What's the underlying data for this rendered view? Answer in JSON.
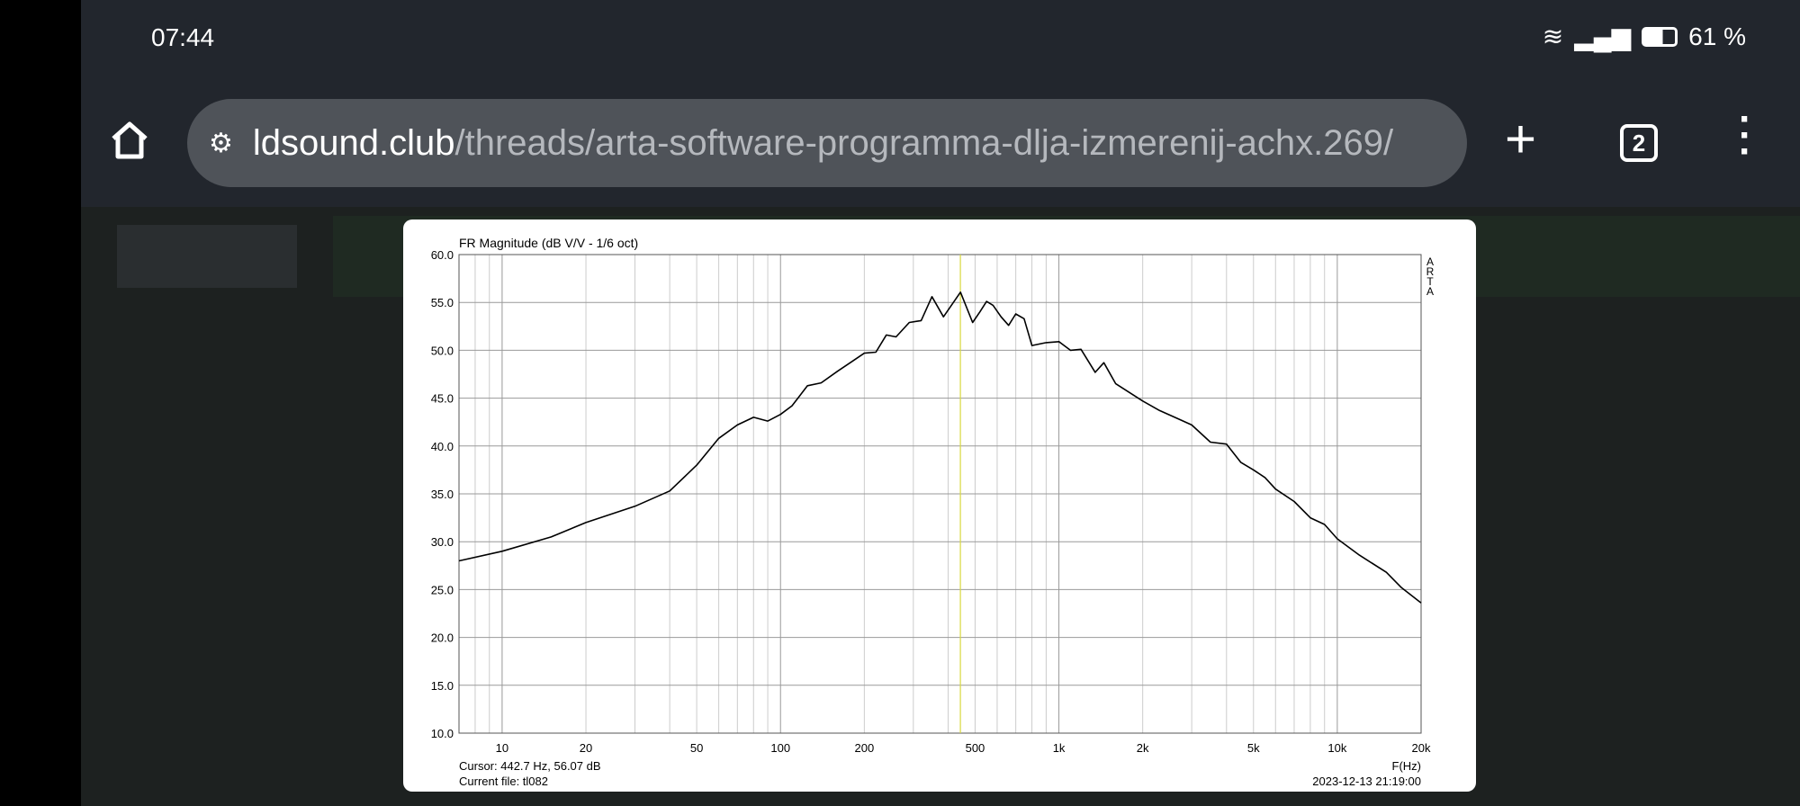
{
  "status_bar": {
    "time": "07:44",
    "battery": "61 %"
  },
  "browser": {
    "url_host": "ldsound.club",
    "url_path": "/threads/arta-software-programma-dlja-izmerenij-achx.269/",
    "tab_count": "2"
  },
  "chart_data": {
    "type": "line",
    "title": "FR Magnitude (dB V/V - 1/6 oct)",
    "xlabel": "F(Hz)",
    "x_scale": "log",
    "xlim": [
      7,
      20000
    ],
    "ylim": [
      10,
      60
    ],
    "yticks": [
      "60.0",
      "55.0",
      "50.0",
      "45.0",
      "40.0",
      "35.0",
      "30.0",
      "25.0",
      "20.0",
      "15.0",
      "10.0"
    ],
    "xticks": [
      {
        "v": 10,
        "l": "10"
      },
      {
        "v": 20,
        "l": "20"
      },
      {
        "v": 50,
        "l": "50"
      },
      {
        "v": 100,
        "l": "100"
      },
      {
        "v": 200,
        "l": "200"
      },
      {
        "v": 500,
        "l": "500"
      },
      {
        "v": 1000,
        "l": "1k"
      },
      {
        "v": 2000,
        "l": "2k"
      },
      {
        "v": 5000,
        "l": "5k"
      },
      {
        "v": 10000,
        "l": "10k"
      },
      {
        "v": 20000,
        "l": "20k"
      }
    ],
    "grid": true,
    "watermark": "ARTA",
    "cursor": {
      "freq": 442.7,
      "text": "Cursor: 442.7 Hz, 56.07 dB"
    },
    "current_file": "Current file: tl082",
    "timestamp": "2023-12-13  21:19:00",
    "series": [
      {
        "name": "tl082",
        "color": "#000000",
        "x": [
          7,
          10,
          15,
          20,
          30,
          40,
          50,
          60,
          70,
          80,
          90,
          100,
          110,
          125,
          140,
          160,
          180,
          200,
          220,
          240,
          260,
          290,
          320,
          350,
          385,
          443,
          490,
          520,
          550,
          580,
          620,
          660,
          700,
          750,
          800,
          900,
          1000,
          1100,
          1200,
          1350,
          1450,
          1600,
          2000,
          2300,
          2700,
          3000,
          3500,
          4000,
          4500,
          5000,
          5500,
          6000,
          7000,
          8000,
          9000,
          10000,
          12000,
          15000,
          17000,
          20000
        ],
        "y": [
          28.0,
          29.0,
          30.5,
          32.0,
          33.7,
          35.3,
          38.0,
          40.8,
          42.2,
          43.0,
          42.6,
          43.3,
          44.2,
          46.3,
          46.6,
          47.8,
          48.8,
          49.7,
          49.8,
          51.6,
          51.4,
          52.9,
          53.1,
          55.6,
          53.5,
          56.07,
          52.9,
          54.0,
          55.1,
          54.7,
          53.5,
          52.6,
          53.8,
          53.3,
          50.5,
          50.8,
          50.9,
          50.0,
          50.1,
          47.7,
          48.7,
          46.5,
          44.7,
          43.7,
          42.8,
          42.2,
          40.4,
          40.2,
          38.3,
          37.5,
          36.7,
          35.5,
          34.2,
          32.5,
          31.8,
          30.3,
          28.6,
          26.8,
          25.2,
          23.6
        ]
      }
    ]
  }
}
